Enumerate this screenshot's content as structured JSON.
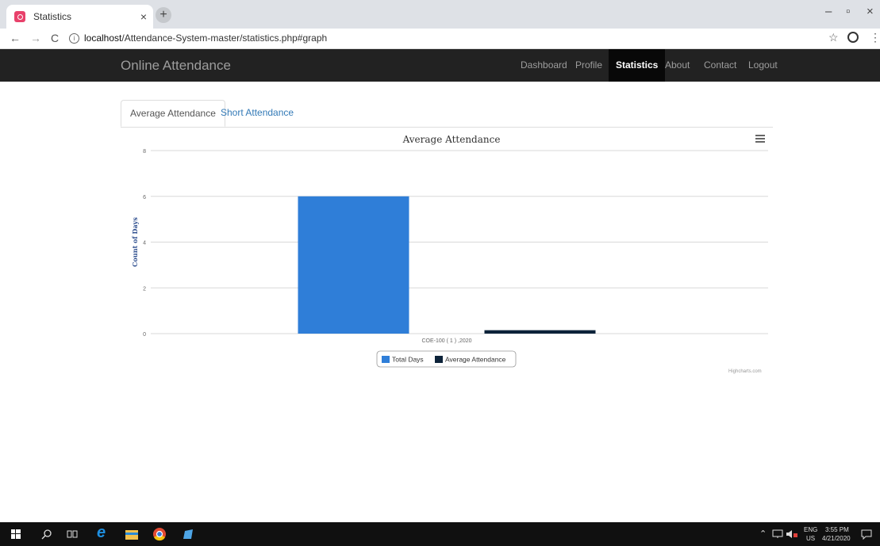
{
  "browser": {
    "tab_title": "Statistics",
    "tab_close": "×",
    "new_tab": "+",
    "url_host": "localhost",
    "url_path": "/Attendance-System-master/statistics.php#graph",
    "back": "←",
    "forward": "→",
    "reload": "C",
    "info": "i",
    "bookmark": "☆",
    "menu": "⋮",
    "minimize": "–",
    "maximize": "▫",
    "close": "×"
  },
  "navbar": {
    "brand": "Online Attendance",
    "links": [
      "Dashboard",
      "Profile",
      "Statistics",
      "About",
      "Contact",
      "Logout"
    ],
    "active": "Statistics"
  },
  "tabs": {
    "active_label": "Average Attendance",
    "inactive_label": "Short Attendance"
  },
  "chart_data": {
    "type": "bar",
    "title": "Average Attendance",
    "ylabel": "Count of Days",
    "xlabel": "",
    "categories": [
      "COE-100 ( 1 ) ,2020"
    ],
    "series": [
      {
        "name": "Total Days",
        "values": [
          6
        ],
        "color": "#2f7ed8"
      },
      {
        "name": "Average Attendance",
        "values": [
          0.15
        ],
        "color": "#0d233a"
      }
    ],
    "ylim": [
      0,
      8
    ],
    "yticks": [
      0,
      2,
      4,
      6,
      8
    ],
    "grid": true,
    "legend": "bottom-center",
    "credits": "Highcharts.com"
  },
  "taskbar": {
    "lang_top": "ENG",
    "lang_bottom": "US",
    "time": "3:55 PM",
    "date": "4/21/2020"
  }
}
